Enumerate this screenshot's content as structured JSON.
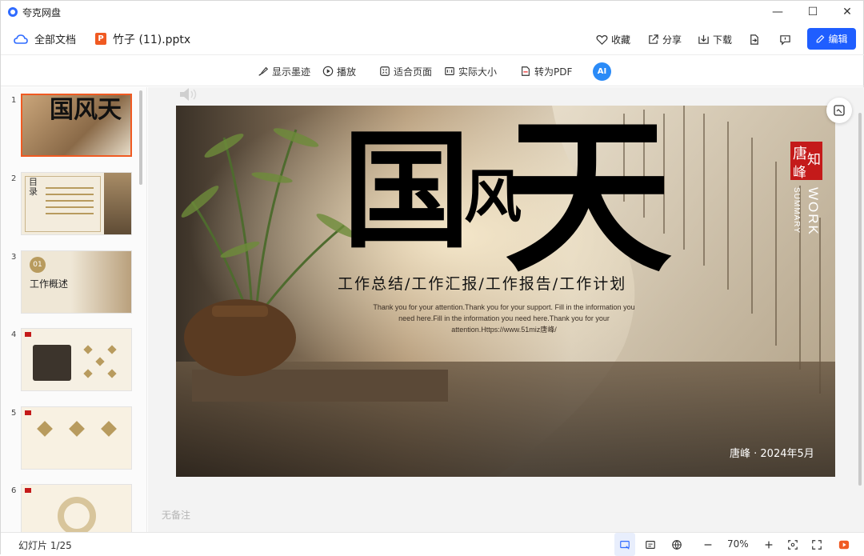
{
  "window": {
    "app_title": "夸克网盘",
    "controls": {
      "minimize": "—",
      "maximize": "☐",
      "close": "✕"
    }
  },
  "docbar": {
    "all_docs": "全部文档",
    "file_badge": "P",
    "file_name": "竹子 (11).pptx",
    "actions": {
      "favorite": "收藏",
      "share": "分享",
      "download": "下载",
      "edit": "编辑"
    }
  },
  "toolbar": {
    "show_ink": "显示墨迹",
    "play": "播放",
    "fit_page": "适合页面",
    "actual_size": "实际大小",
    "to_pdf": "转为PDF",
    "ai_label": "AI"
  },
  "sidebar": {
    "thumbnails": [
      {
        "num": "1",
        "text": "国风天"
      },
      {
        "num": "2",
        "text": "目录"
      },
      {
        "num": "3",
        "text": "工作概述",
        "badge": "01"
      },
      {
        "num": "4",
        "text": ""
      },
      {
        "num": "5",
        "text": ""
      },
      {
        "num": "6",
        "text": ""
      }
    ]
  },
  "slide": {
    "big_chars": [
      "国",
      "风",
      "天"
    ],
    "subtitle": "工作总结/工作汇报/工作报告/工作计划",
    "body_line1": "Thank you for your attention.Thank you for your support. Fill in the information you",
    "body_line2": "need here.Fill in the information you need here.Thank you for your",
    "body_line3": "attention.Https://www.51miz唐峰/",
    "seal_chars": [
      "唐",
      "知",
      "峰"
    ],
    "work": "WORK",
    "summary": "SUMMARY",
    "author_date": "唐峰 · 2024年5月"
  },
  "notes": {
    "placeholder": "无备注"
  },
  "status": {
    "slide_counter": "幻灯片 1/25",
    "zoom_level": "70%"
  },
  "colors": {
    "accent_blue": "#1f5eff",
    "ppt_orange": "#f05a22",
    "seal_red": "#c41a1a"
  }
}
